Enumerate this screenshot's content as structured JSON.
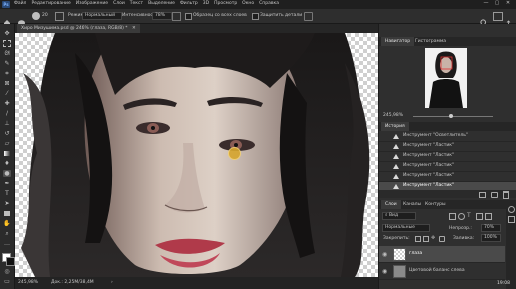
{
  "menubar": {
    "app_icon": "Ps",
    "items": [
      "Файл",
      "Редактирование",
      "Изображение",
      "Слои",
      "Текст",
      "Выделение",
      "Фильтр",
      "3D",
      "Просмотр",
      "Окно",
      "Справка"
    ],
    "window_controls": [
      "—",
      "▢",
      "✕"
    ]
  },
  "options": {
    "mode_label": "Режим:",
    "mode_value": "Нормальный",
    "intensity_label": "Интенсивность:",
    "intensity_value": "78%",
    "sample_all": "Образец со всех слоев",
    "protect_detail": "Защитить детали"
  },
  "document": {
    "tab_title": "Хиро Мизушима.psd @ 246% (глаза, RGB/8) *",
    "close_glyph": "✕"
  },
  "status": {
    "zoom": "245,98%",
    "doc_info": "Док.: 2,25M/38,4M"
  },
  "navigator": {
    "tabs": [
      "Навигатор",
      "Гистограмма"
    ],
    "zoom": "245,98%"
  },
  "history": {
    "title": "История",
    "items": [
      "Инструмент \"Осветлитель\"",
      "Инструмент \"Ластик\"",
      "Инструмент \"Ластик\"",
      "Инструмент \"Ластик\"",
      "Инструмент \"Ластик\"",
      "Инструмент \"Ластик\""
    ]
  },
  "layers": {
    "tabs": [
      "Слои",
      "Каналы",
      "Контуры"
    ],
    "kind_filter": "Вид",
    "blend_mode": "Нормальные",
    "opacity_label": "Непрозр.:",
    "opacity_value": "70%",
    "lock_label": "Закрепить:",
    "fill_label": "Заливка:",
    "fill_value": "100%",
    "items": [
      "глаза",
      "Цветовой баланс слева"
    ]
  },
  "clock": {
    "time": "19:08"
  },
  "colors": {
    "accent": "#e8b23a",
    "panel_bg": "#2f2f2f",
    "menubar_bg": "#1f1f1f"
  }
}
